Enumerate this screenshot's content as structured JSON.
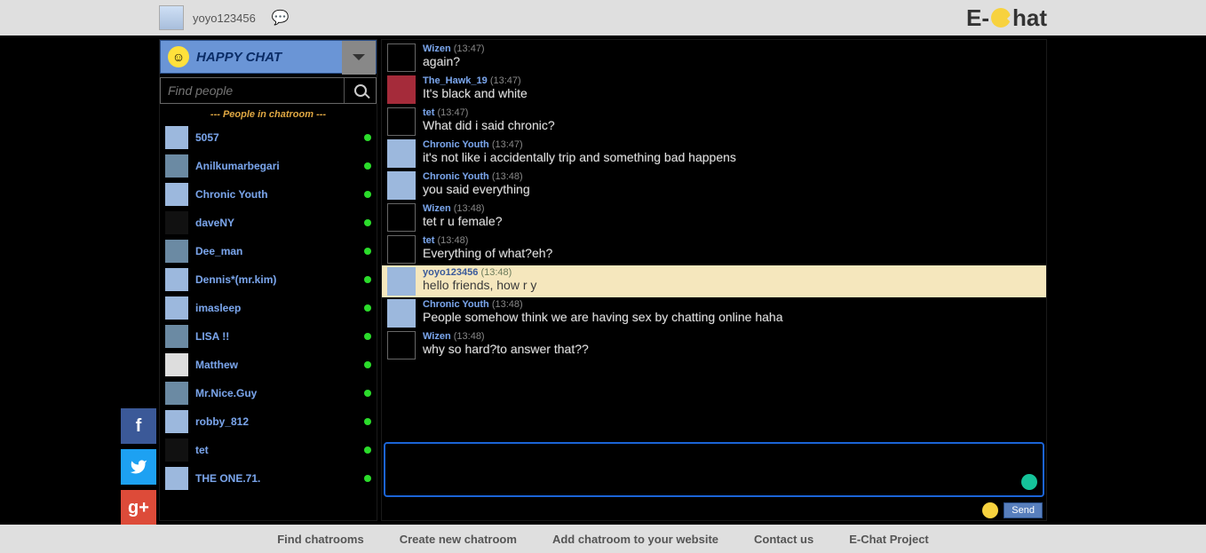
{
  "header": {
    "username": "yoyo123456",
    "logo_prefix": "E-",
    "logo_suffix": "hat"
  },
  "room": {
    "title": "HAPPY CHAT",
    "search_placeholder": "Find people",
    "people_header": "--- People in chatroom ---"
  },
  "people": [
    {
      "name": "5057",
      "avatar": "generic"
    },
    {
      "name": "Anilkumarbegari",
      "avatar": "photo"
    },
    {
      "name": "Chronic Youth",
      "avatar": "generic"
    },
    {
      "name": "daveNY",
      "avatar": "dark"
    },
    {
      "name": "Dee_man",
      "avatar": "photo"
    },
    {
      "name": "Dennis*(mr.kim)",
      "avatar": "generic"
    },
    {
      "name": "imasleep",
      "avatar": "generic"
    },
    {
      "name": "LISA !!",
      "avatar": "photo"
    },
    {
      "name": "Matthew",
      "avatar": "icon"
    },
    {
      "name": "Mr.Nice.Guy",
      "avatar": "photo"
    },
    {
      "name": "robby_812",
      "avatar": "generic"
    },
    {
      "name": "tet",
      "avatar": "dark"
    },
    {
      "name": "THE ONE.71.",
      "avatar": "generic"
    }
  ],
  "messages": [
    {
      "name": "Wizen",
      "time": "(13:47)",
      "text": "again?",
      "avatar": "dark"
    },
    {
      "name": "The_Hawk_19",
      "time": "(13:47)",
      "text": "It's black and white",
      "avatar": "red"
    },
    {
      "name": "tet",
      "time": "(13:47)",
      "text": "What did i said chronic?",
      "avatar": "dark"
    },
    {
      "name": "Chronic Youth",
      "time": "(13:47)",
      "text": "it's not like i accidentally trip and something bad happens",
      "avatar": "generic"
    },
    {
      "name": "Chronic Youth",
      "time": "(13:48)",
      "text": "you said everything",
      "avatar": "generic"
    },
    {
      "name": "Wizen",
      "time": "(13:48)",
      "text": "tet r u female?",
      "avatar": "dark"
    },
    {
      "name": "tet",
      "time": "(13:48)",
      "text": "Everything of what?eh?",
      "avatar": "dark"
    },
    {
      "name": "yoyo123456",
      "time": "(13:48)",
      "text": "hello friends, how r y",
      "avatar": "generic",
      "self": true
    },
    {
      "name": "Chronic Youth",
      "time": "(13:48)",
      "text": "People somehow think we are having sex by chatting online haha",
      "avatar": "generic"
    },
    {
      "name": "Wizen",
      "time": "(13:48)",
      "text": "why so hard?to answer that??",
      "avatar": "dark"
    }
  ],
  "send_label": "Send",
  "footer": {
    "find": "Find chatrooms",
    "create": "Create new chatroom",
    "add": "Add chatroom to your website",
    "contact": "Contact us",
    "project": "E-Chat Project"
  },
  "social": {
    "fb": "f",
    "tw": "t",
    "gp": "g+"
  }
}
